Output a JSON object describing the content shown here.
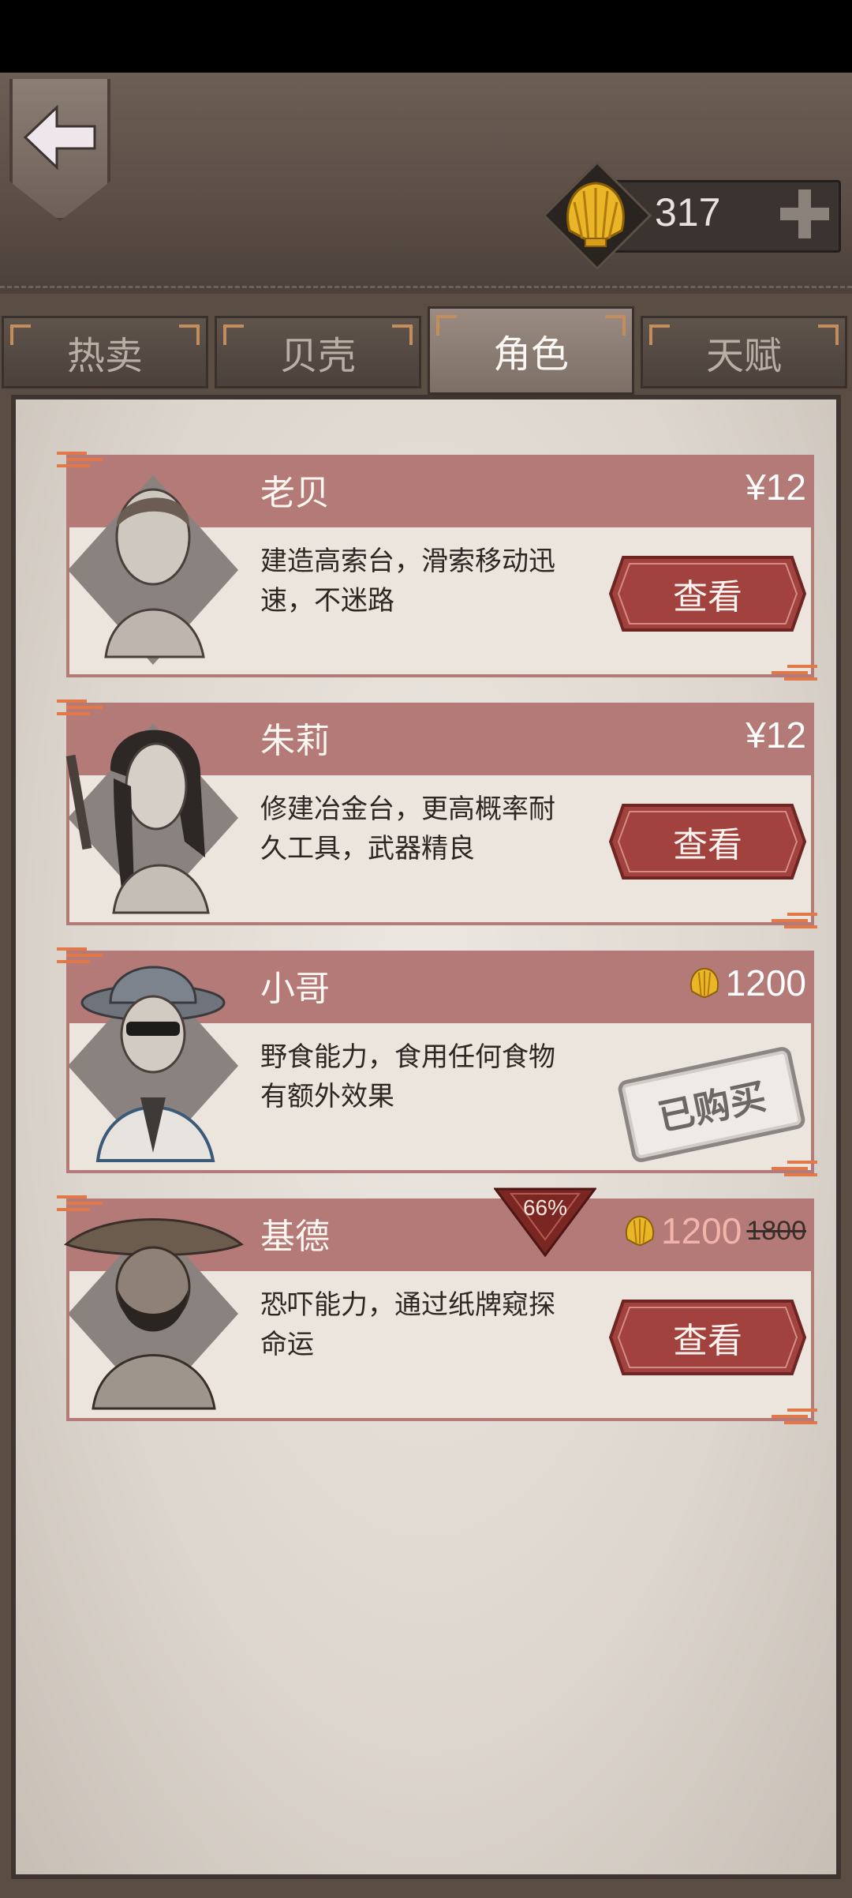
{
  "currency": {
    "shells": "317"
  },
  "tabs": [
    {
      "label": "热卖"
    },
    {
      "label": "贝壳"
    },
    {
      "label": "角色",
      "active": true
    },
    {
      "label": "天赋"
    }
  ],
  "characters": [
    {
      "name": "老贝",
      "price": "¥12",
      "price_type": "cash",
      "description": "建造高索台，滑索移动迅速，不迷路",
      "action": "查看"
    },
    {
      "name": "朱莉",
      "price": "¥12",
      "price_type": "cash",
      "description": "修建冶金台，更高概率耐久工具，武器精良",
      "action": "查看"
    },
    {
      "name": "小哥",
      "price": "1200",
      "price_type": "shell",
      "description": "野食能力，食用任何食物有额外效果",
      "status": "已购买"
    },
    {
      "name": "基德",
      "price": "1200",
      "original_price": "1800",
      "discount": "66%",
      "price_type": "shell",
      "description": "恐吓能力，通过纸牌窥探命运",
      "action": "查看"
    }
  ],
  "colors": {
    "card_header": "#b47a77",
    "button": "#a1423e",
    "panel": "#ece7e1",
    "tab_active": "#8c7f76"
  }
}
